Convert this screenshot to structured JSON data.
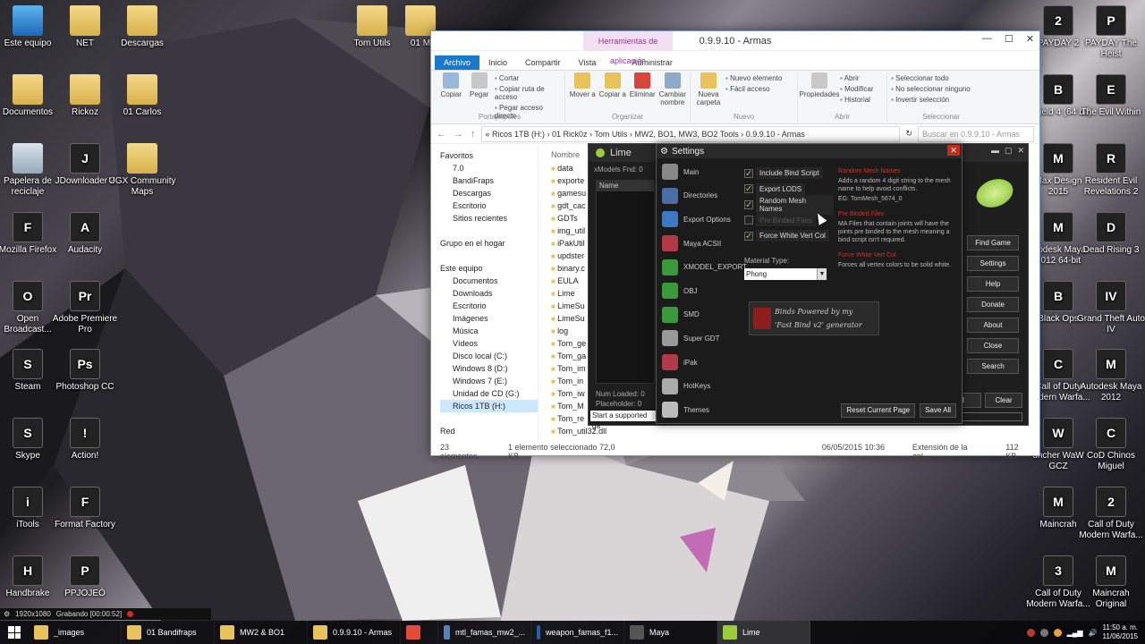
{
  "desktop": {
    "icons": [
      {
        "label": "Este equipo",
        "glyph": "",
        "kind": "pc"
      },
      {
        "label": "NET",
        "glyph": "",
        "kind": "folder"
      },
      {
        "label": "Descargas",
        "glyph": "",
        "kind": "folder"
      },
      {
        "label": "Tom Utils",
        "glyph": "",
        "kind": "folder"
      },
      {
        "label": "01 M",
        "glyph": "",
        "kind": "folder"
      },
      {
        "label": "Documentos",
        "glyph": "",
        "kind": "folder"
      },
      {
        "label": "Rickoz",
        "glyph": "",
        "kind": "folder"
      },
      {
        "label": "01 Carlos",
        "glyph": "",
        "kind": "folder"
      },
      {
        "label": "Papelera de reciclaje",
        "glyph": "",
        "kind": "bin"
      },
      {
        "label": "JDownloader 2",
        "glyph": "J",
        "kind": "app"
      },
      {
        "label": "UGX Community Maps",
        "glyph": "",
        "kind": "folder"
      },
      {
        "label": "Mozilla Firefox",
        "glyph": "F",
        "kind": "app"
      },
      {
        "label": "Audacity",
        "glyph": "A",
        "kind": "app"
      },
      {
        "label": "Open Broadcast...",
        "glyph": "O",
        "kind": "app"
      },
      {
        "label": "Adobe Premiere Pro",
        "glyph": "Pr",
        "kind": "app"
      },
      {
        "label": "Steam",
        "glyph": "S",
        "kind": "app"
      },
      {
        "label": "Photoshop CC",
        "glyph": "Ps",
        "kind": "app"
      },
      {
        "label": "Skype",
        "glyph": "S",
        "kind": "app"
      },
      {
        "label": "Action!",
        "glyph": "!",
        "kind": "app"
      },
      {
        "label": "iTools",
        "glyph": "i",
        "kind": "app"
      },
      {
        "label": "Format Factory",
        "glyph": "F",
        "kind": "app"
      },
      {
        "label": "Handbrake",
        "glyph": "H",
        "kind": "app"
      },
      {
        "label": "PPJOJEÓ",
        "glyph": "P",
        "kind": "app"
      },
      {
        "label": "PAYDAY 2",
        "glyph": "2",
        "kind": "app"
      },
      {
        "label": "PAYDAY The Heist",
        "glyph": "P",
        "kind": "app"
      },
      {
        "label": "ttlefield 4 (64 bit)",
        "glyph": "B",
        "kind": "app"
      },
      {
        "label": "The Evil Within",
        "glyph": "E",
        "kind": "app"
      },
      {
        "label": "Max Design 2015",
        "glyph": "M",
        "kind": "app"
      },
      {
        "label": "Resident Evil Revelations 2",
        "glyph": "R",
        "kind": "app"
      },
      {
        "label": "utodesk Maya 2012 64-bit",
        "glyph": "M",
        "kind": "app"
      },
      {
        "label": "Dead Rising 3",
        "glyph": "D",
        "kind": "app"
      },
      {
        "label": "Black Ops",
        "glyph": "B",
        "kind": "app"
      },
      {
        "label": "Grand Theft Auto IV",
        "glyph": "IV",
        "kind": "app"
      },
      {
        "label": "Call of Duty Modern Warfa...",
        "glyph": "C",
        "kind": "app"
      },
      {
        "label": "Autodesk Maya 2012",
        "glyph": "M",
        "kind": "app"
      },
      {
        "label": "uncher WaW GCZ",
        "glyph": "W",
        "kind": "app"
      },
      {
        "label": "CoD Chinos Miguel",
        "glyph": "C",
        "kind": "app"
      },
      {
        "label": "Maincrah",
        "glyph": "M",
        "kind": "app"
      },
      {
        "label": "Call of Duty Modern Warfa...",
        "glyph": "2",
        "kind": "app"
      },
      {
        "label": "Call of Duty Modern Warfa...",
        "glyph": "3",
        "kind": "app"
      },
      {
        "label": "Maincrah Original",
        "glyph": "M",
        "kind": "app"
      }
    ]
  },
  "explorer": {
    "title": "0.9.9.10 - Armas",
    "context_tab": "Herramientas de aplicación",
    "tabs": [
      "Archivo",
      "Inicio",
      "Compartir",
      "Vista",
      "Administrar"
    ],
    "ribbon": {
      "copy": "Copiar",
      "paste": "Pegar",
      "cut": "Cortar",
      "copy_path": "Copiar ruta de acceso",
      "paste_shortcut": "Pegar acceso directo",
      "group_clipboard": "Portapapeles",
      "move": "Mover a",
      "copy_to": "Copiar a",
      "delete": "Eliminar",
      "rename": "Cambiar nombre",
      "group_organize": "Organizar",
      "new_folder": "Nueva carpeta",
      "new_item": "Nuevo elemento",
      "easy_access": "Fácil acceso",
      "group_new": "Nuevo",
      "properties": "Propiedades",
      "open": "Abrir",
      "modify": "Modificar",
      "history": "Historial",
      "group_open": "Abrir",
      "select_all": "Seleccionar todo",
      "select_none": "No seleccionar ninguno",
      "invert": "Invertir selección",
      "group_select": "Seleccionar"
    },
    "address": "«  Ricos 1TB (H:)  ›  01 Rick0z  ›  Tom Utils  ›  MW2, BO1, MW3, BO2 Tools  ›  0.9.9.10 - Armas",
    "search_placeholder": "Buscar en 0.9.9.10 - Armas",
    "nav": [
      {
        "label": "Favoritos",
        "sub": false
      },
      {
        "label": "7.0",
        "sub": true
      },
      {
        "label": "BandiFraps",
        "sub": true
      },
      {
        "label": "Descargas",
        "sub": true
      },
      {
        "label": "Escritorio",
        "sub": true
      },
      {
        "label": "Sitios recientes",
        "sub": true
      },
      {
        "label": "",
        "sub": false
      },
      {
        "label": "Grupo en el hogar",
        "sub": false
      },
      {
        "label": "",
        "sub": false
      },
      {
        "label": "Este equipo",
        "sub": false
      },
      {
        "label": "Documentos",
        "sub": true
      },
      {
        "label": "Downloads",
        "sub": true
      },
      {
        "label": "Escritorio",
        "sub": true
      },
      {
        "label": "Imágenes",
        "sub": true
      },
      {
        "label": "Música",
        "sub": true
      },
      {
        "label": "Vídeos",
        "sub": true
      },
      {
        "label": "Disco local (C:)",
        "sub": true
      },
      {
        "label": "Windows 8 (D:)",
        "sub": true
      },
      {
        "label": "Windows 7 (E:)",
        "sub": true
      },
      {
        "label": "Unidad de CD (G:)",
        "sub": true
      },
      {
        "label": "Ricos 1TB (H:)",
        "sub": true
      },
      {
        "label": "",
        "sub": false
      },
      {
        "label": "Red",
        "sub": false
      }
    ],
    "file_header": "Nombre",
    "files": [
      "data",
      "exporte",
      "gamesu",
      "gdt_cac",
      "GDTs",
      "img_util",
      "iPakUtil",
      "updster",
      "binary.c",
      "EULA",
      "Lime",
      "LimeSu",
      "LimeSu",
      "log",
      "Tom_ge",
      "Tom_ga",
      "Tom_im",
      "Tom_in",
      "Tom_iw",
      "Tom_M",
      "Tom_re",
      "Tom_util32.dll"
    ],
    "status_count": "23 elementos",
    "status_selected": "1 elemento seleccionado  72,0 KB",
    "row_date": "06/05/2015 10:36 ...",
    "row_type": "Extensión de la apl...",
    "row_size": "112 KB"
  },
  "lime": {
    "title": "Lime",
    "models_found": "xModels Fnd: 0",
    "list_header": "Name",
    "num_loaded": "Num Loaded: 0",
    "placeholder": "Placeholder: 0",
    "status": "Start a supported ga",
    "buttons": [
      "Find Game",
      "Settings",
      "Help",
      "Donate",
      "About",
      "Close",
      "Search"
    ],
    "bottom_buttons": [
      "ll",
      "Clear"
    ]
  },
  "settings": {
    "title": "Settings",
    "sidebar": [
      {
        "label": "Main",
        "color": "#888"
      },
      {
        "label": "Directories",
        "color": "#4a6fa5"
      },
      {
        "label": "Export Options",
        "color": "#3c78c3"
      },
      {
        "label": "Maya ACSII",
        "color": "#b23a48"
      },
      {
        "label": "XMODEL_EXPORT",
        "color": "#3a9a3a"
      },
      {
        "label": "OBJ",
        "color": "#3a9a3a"
      },
      {
        "label": "SMD",
        "color": "#3a9a3a"
      },
      {
        "label": "Super GDT",
        "color": "#999"
      },
      {
        "label": "iPak",
        "color": "#b23a48"
      },
      {
        "label": "HotKeys",
        "color": "#aaa"
      },
      {
        "label": "Themes",
        "color": "#bbb"
      }
    ],
    "options": [
      {
        "label": "Include Bind Script",
        "checked": true,
        "enabled": true
      },
      {
        "label": "Export LODS",
        "checked": true,
        "enabled": true
      },
      {
        "label": "Random Mesh Names",
        "checked": true,
        "enabled": true
      },
      {
        "label": "Pre Binded Files",
        "checked": false,
        "enabled": false
      },
      {
        "label": "Force White Vert Col",
        "checked": true,
        "enabled": true
      }
    ],
    "material_label": "Material Type:",
    "material_value": "Phong",
    "desc": {
      "random_title": "Random Mesh Names",
      "random_p1": "Adds a random 4 digit string to the mesh name to help avoid conflicts.",
      "random_eg": "EG: TomMesh_5674_0",
      "prebind_title": "Pre Binded Files",
      "prebind_p1": "MA Files that contain joints will have the joints pre binded to the mesh meaning a bind script isn't required.",
      "white_title": "Force White Vert Col",
      "white_p1": "Forces all vertex colors to be solid white."
    },
    "banner_line1": "Binds Powered by my",
    "banner_line2": "'Fast Bind v2' generator",
    "reset_button": "Reset Current Page",
    "save_button": "Save All"
  },
  "recording": {
    "resolution": "1920x1080",
    "status": "Grabando [00:00:52]"
  },
  "taskbar": {
    "items": [
      {
        "label": "_images",
        "color": "#e8c25a",
        "active": false
      },
      {
        "label": "01 Bandifraps",
        "color": "#e8c25a",
        "active": false
      },
      {
        "label": "MW2 & BO1",
        "color": "#e8c25a",
        "active": false
      },
      {
        "label": "0.9.9.10 - Armas",
        "color": "#e8c25a",
        "active": false
      },
      {
        "label": "",
        "color": "#e64a3b",
        "active": false
      },
      {
        "label": "mtl_famas_mw2_...",
        "color": "#5c7fb5",
        "active": false
      },
      {
        "label": "weapon_famas_f1...",
        "color": "#2a5ca8",
        "active": false
      },
      {
        "label": "Maya",
        "color": "#555",
        "active": false
      },
      {
        "label": "Lime",
        "color": "#9ccc3a",
        "active": true
      }
    ],
    "time": "11:50 a. m.",
    "date": "11/06/2015"
  }
}
